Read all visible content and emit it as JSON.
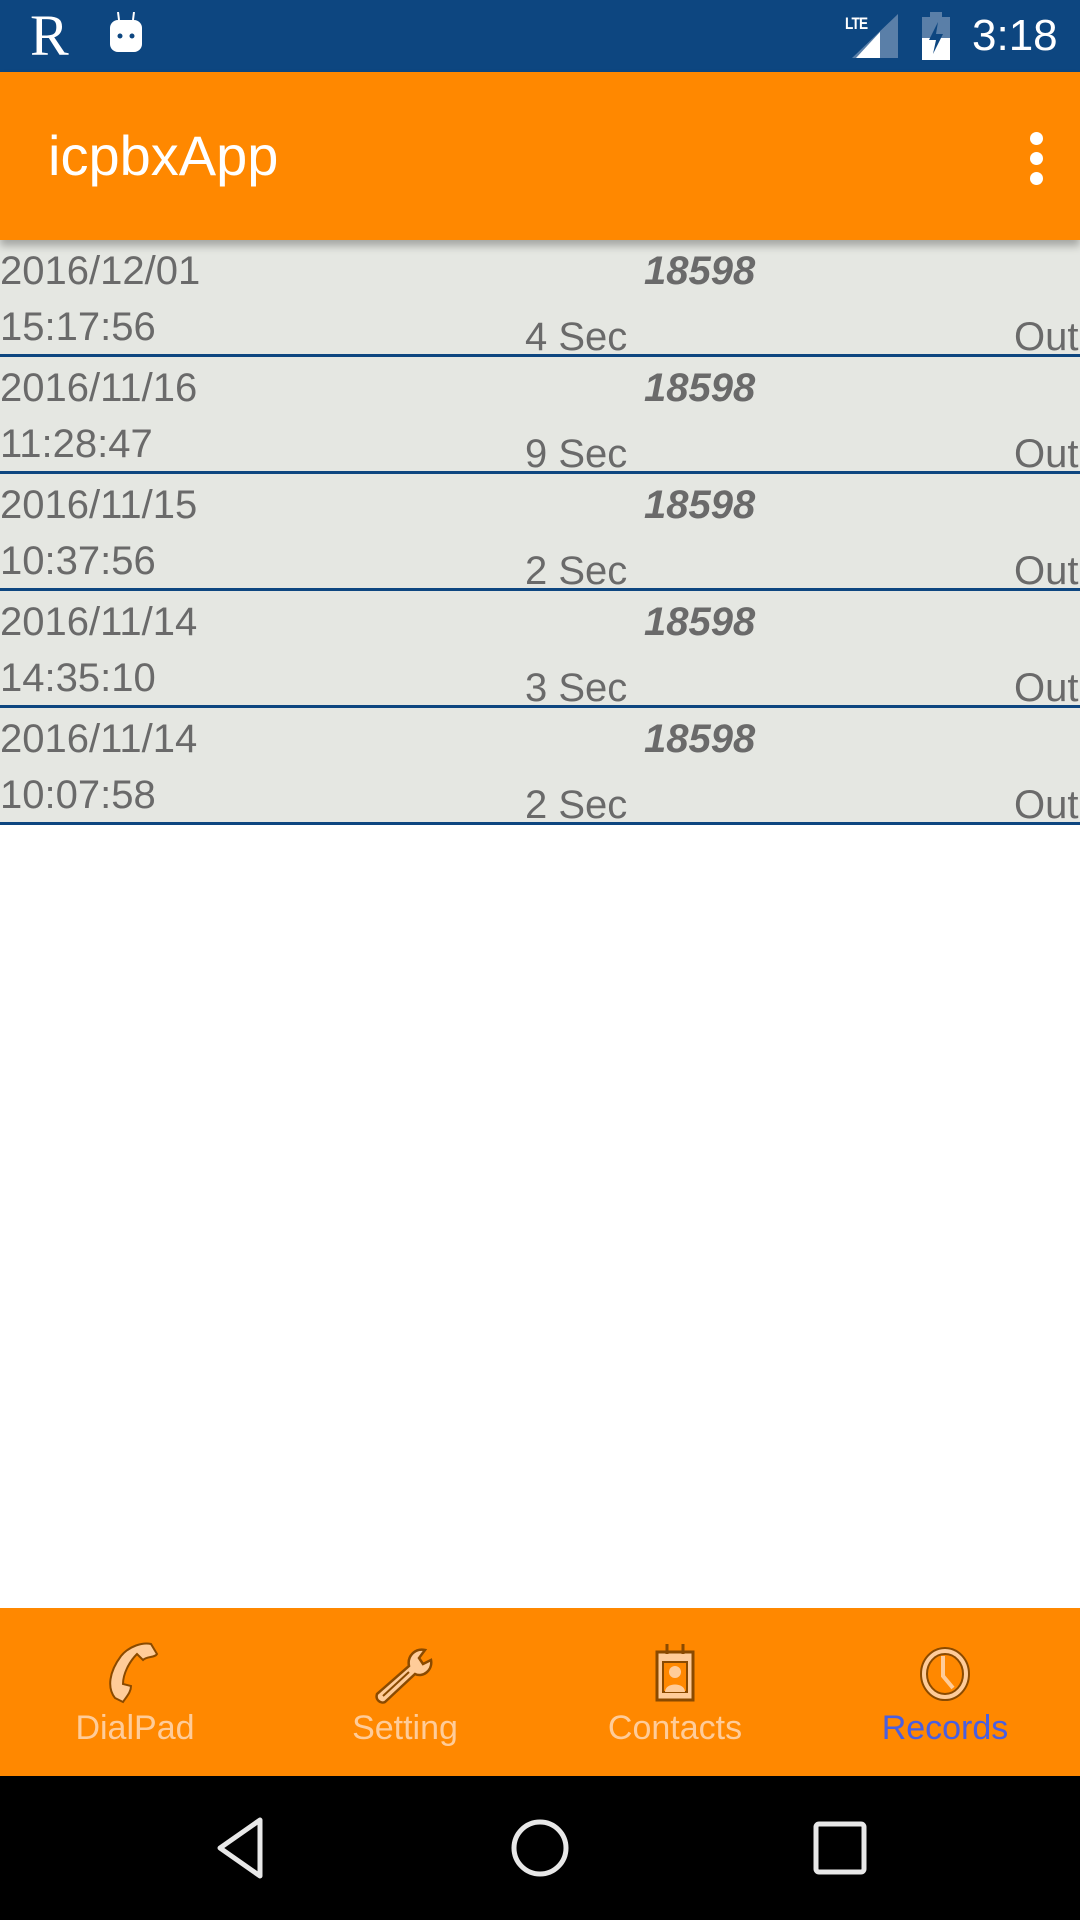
{
  "status_bar": {
    "left_icons": [
      "r-app-icon",
      "android-robot-icon"
    ],
    "r_glyph": "R",
    "network": "LTE",
    "time": "3:18"
  },
  "app_bar": {
    "title": "icpbxApp",
    "overflow_icon": "more-vert-icon"
  },
  "records": [
    {
      "date": "2016/12/01",
      "time": "15:17:56",
      "number": "18598",
      "duration": "4 Sec",
      "direction": "Out"
    },
    {
      "date": "2016/11/16",
      "time": "11:28:47",
      "number": "18598",
      "duration": "9 Sec",
      "direction": "Out"
    },
    {
      "date": "2016/11/15",
      "time": "10:37:56",
      "number": "18598",
      "duration": "2 Sec",
      "direction": "Out"
    },
    {
      "date": "2016/11/14",
      "time": "14:35:10",
      "number": "18598",
      "duration": "3 Sec",
      "direction": "Out"
    },
    {
      "date": "2016/11/14",
      "time": "10:07:58",
      "number": "18598",
      "duration": "2 Sec",
      "direction": "Out"
    }
  ],
  "bottom_nav": {
    "tabs": [
      {
        "label": "DialPad",
        "icon": "phone-icon",
        "active": false
      },
      {
        "label": "Setting",
        "icon": "wrench-icon",
        "active": false
      },
      {
        "label": "Contacts",
        "icon": "contact-card-icon",
        "active": false
      },
      {
        "label": "Records",
        "icon": "clock-icon",
        "active": true
      }
    ]
  },
  "colors": {
    "status_bar": "#0d4680",
    "primary": "#ff8800",
    "row_background": "#e5e7e2",
    "divider": "#0d4680",
    "active_tab": "#4a5fe0",
    "inactive_tab": "#ffcc99"
  },
  "system_nav": {
    "buttons": [
      "back",
      "home",
      "recents"
    ]
  }
}
